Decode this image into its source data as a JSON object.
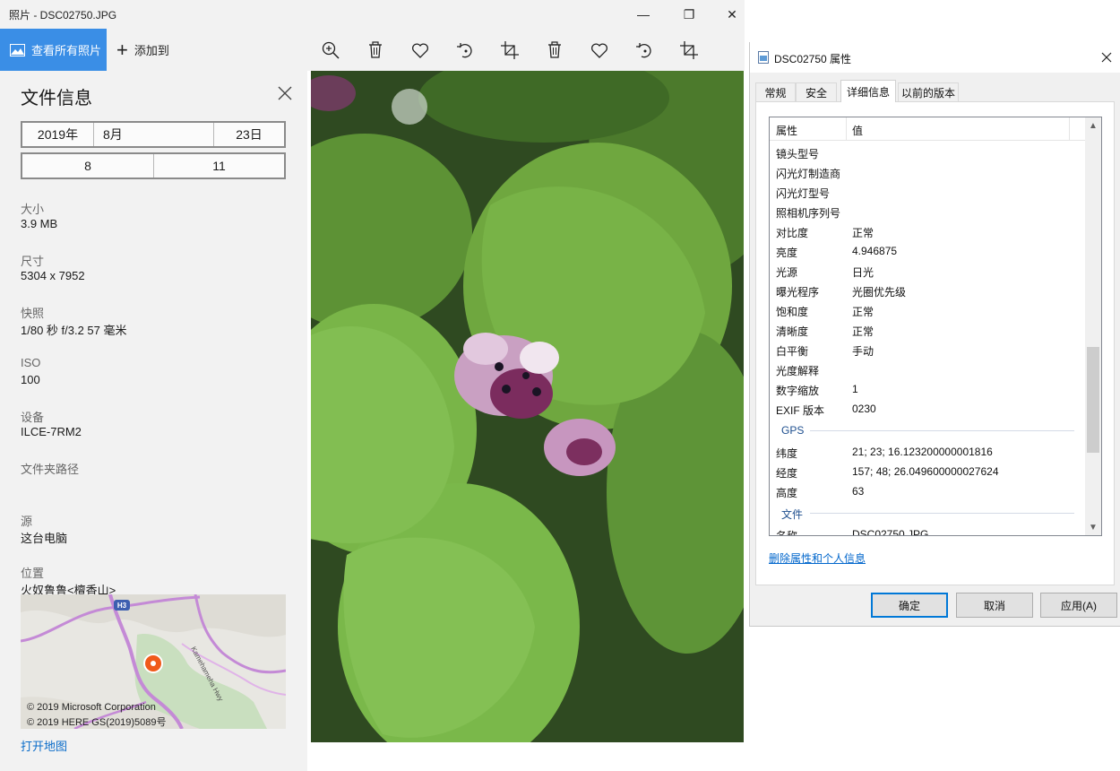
{
  "window": {
    "title": "照片 - DSC02750.JPG",
    "minimize_glyph": "—",
    "maximize_glyph": "❐",
    "close_glyph": "✕"
  },
  "commandbar": {
    "view_all_label": "查看所有照片",
    "add_to_label": "添加到",
    "tools": [
      "zoom-in-icon",
      "delete-icon",
      "favorite-icon",
      "rotate-icon",
      "crop-icon",
      "delete-icon",
      "favorite-icon",
      "rotate-icon",
      "crop-icon"
    ]
  },
  "info": {
    "title": "文件信息",
    "date": {
      "year": "2019年",
      "month": "8月",
      "day": "23日"
    },
    "time": {
      "hour": "8",
      "minute": "11"
    },
    "fields": [
      {
        "label": "大小",
        "value": "3.9 MB"
      },
      {
        "label": "尺寸",
        "value": "5304 x 7952"
      },
      {
        "label": "快照",
        "value": "1/80 秒 f/3.2 57 毫米"
      },
      {
        "label": "ISO",
        "value": "100"
      },
      {
        "label": "设备",
        "value": "ILCE-7RM2"
      },
      {
        "label": "文件夹路径",
        "value": ""
      },
      {
        "label": "源",
        "value": "这台电脑"
      },
      {
        "label": "位置",
        "value": "火奴鲁鲁<檀香山>"
      }
    ],
    "map": {
      "road_label": "Kamehameha Hwy",
      "shield": "H3",
      "copyright1": "© 2019 Microsoft Corporation",
      "copyright2": "© 2019 HERE GS(2019)5089号",
      "pin_color": "#f05a1a"
    },
    "open_map_label": "打开地图"
  },
  "dialog": {
    "title": "DSC02750 属性",
    "tabs": [
      "常规",
      "安全",
      "详细信息",
      "以前的版本"
    ],
    "active_tab": "详细信息",
    "columns": {
      "name": "属性",
      "value": "值"
    },
    "rows": [
      {
        "name": "镜头型号",
        "value": ""
      },
      {
        "name": "闪光灯制造商",
        "value": ""
      },
      {
        "name": "闪光灯型号",
        "value": ""
      },
      {
        "name": "照相机序列号",
        "value": ""
      },
      {
        "name": "对比度",
        "value": "正常"
      },
      {
        "name": "亮度",
        "value": "4.946875"
      },
      {
        "name": "光源",
        "value": "日光"
      },
      {
        "name": "曝光程序",
        "value": "光圈优先级"
      },
      {
        "name": "饱和度",
        "value": "正常"
      },
      {
        "name": "清晰度",
        "value": "正常"
      },
      {
        "name": "白平衡",
        "value": "手动"
      },
      {
        "name": "光度解释",
        "value": ""
      },
      {
        "name": "数字缩放",
        "value": "1"
      },
      {
        "name": "EXIF 版本",
        "value": "0230"
      }
    ],
    "gps_group": "GPS",
    "gps_rows": [
      {
        "name": "纬度",
        "value": "21; 23; 16.123200000001816"
      },
      {
        "name": "经度",
        "value": "157; 48; 26.049600000027624"
      },
      {
        "name": "高度",
        "value": "63"
      }
    ],
    "file_group": "文件",
    "file_rows": [
      {
        "name": "名称",
        "value": "DSC02750.JPG"
      }
    ],
    "remove_link": "删除属性和个人信息",
    "buttons": {
      "ok": "确定",
      "cancel": "取消",
      "apply": "应用(A)"
    }
  },
  "colors": {
    "accent": "#3a8ee6",
    "link": "#0a6cc9",
    "panel_bg": "#f2f2f2"
  }
}
